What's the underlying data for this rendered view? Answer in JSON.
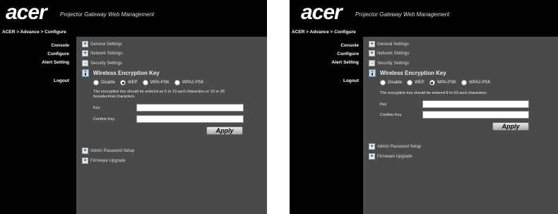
{
  "panels": [
    {
      "logo": "acer",
      "tagline": "Projector Gateway Web Management",
      "breadcrumb": "ACER > Advance > Configure",
      "sidebar": [
        "Console",
        "Configure",
        "Alert Setting",
        "Logout"
      ],
      "sections": {
        "general": "General Settings",
        "network": "Network Settings",
        "security": "Security Settings",
        "admin": "Admin Password Setup",
        "firmware": "Firmware Upgrade"
      },
      "wek_title": "Wireless Encryption Key",
      "radios": [
        "Disable",
        "WEP",
        "WPA-PSK",
        "WPA2-PSK"
      ],
      "selected": "WEP",
      "note": "The encryption key should be entered as 5 or 13 ascii characters or 10 or 26 hexadecimal characters.",
      "key_label": "Key",
      "confirm_label": "Confirm Key",
      "key_value": "",
      "confirm_value": "",
      "apply": "Apply"
    },
    {
      "logo": "acer",
      "tagline": "Projector Gateway Web Management",
      "breadcrumb": "ACER > Advance > Configure",
      "sidebar": [
        "Console",
        "Configure",
        "Alert Setting",
        "Logout"
      ],
      "sections": {
        "general": "General Settings",
        "network": "Network Settings",
        "security": "Security Settings",
        "admin": "Admin Password Setup",
        "firmware": "Firmware Upgrade"
      },
      "wek_title": "Wireless Encryption Key",
      "radios": [
        "Disable",
        "WEP",
        "WPA-PSK",
        "WPA2-PSK"
      ],
      "selected": "WPA-PSK",
      "note": "The encryption key should be entered 8 to 63 ascii characters.",
      "key_label": "Key",
      "confirm_label": "Confirm Key",
      "key_value": "",
      "confirm_value": "",
      "apply": "Apply"
    }
  ]
}
